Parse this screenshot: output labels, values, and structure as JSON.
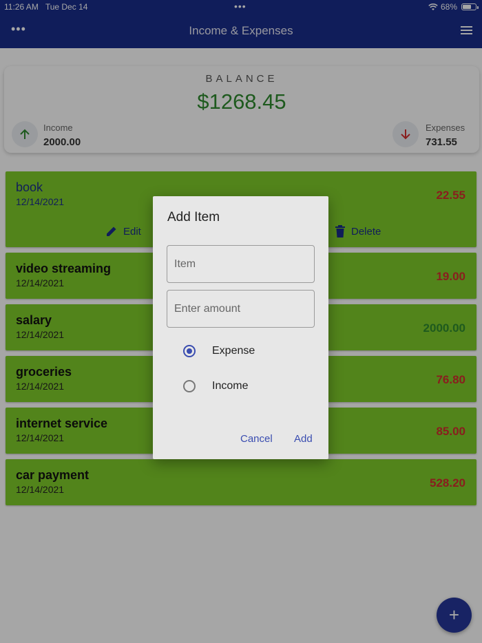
{
  "status_bar": {
    "time": "11:26 AM",
    "date": "Tue Dec 14",
    "battery": "68%",
    "center_dots": "•••"
  },
  "app_bar": {
    "title": "Income & Expenses",
    "more_glyph": "•••"
  },
  "balance": {
    "label": "BALANCE",
    "value": "$1268.45",
    "income_label": "Income",
    "income_value": "2000.00",
    "expenses_label": "Expenses",
    "expenses_value": "731.55"
  },
  "items": [
    {
      "name": "book",
      "date": "12/14/2021",
      "amount": "22.55",
      "type": "expense"
    },
    {
      "name": "video streaming",
      "date": "12/14/2021",
      "amount": "19.00",
      "type": "expense"
    },
    {
      "name": "salary",
      "date": "12/14/2021",
      "amount": "2000.00",
      "type": "income"
    },
    {
      "name": "groceries",
      "date": "12/14/2021",
      "amount": "76.80",
      "type": "expense"
    },
    {
      "name": "internet service",
      "date": "12/14/2021",
      "amount": "85.00",
      "type": "expense"
    },
    {
      "name": "car payment",
      "date": "12/14/2021",
      "amount": "528.20",
      "type": "expense"
    }
  ],
  "item_actions": {
    "edit_label": "Edit",
    "delete_label": "Delete"
  },
  "dialog": {
    "title": "Add Item",
    "item_placeholder": "Item",
    "amount_placeholder": "Enter amount",
    "options": [
      "Expense",
      "Income"
    ],
    "selected": "Expense",
    "cancel_label": "Cancel",
    "add_label": "Add"
  },
  "fab_label": "+",
  "colors": {
    "primary": "#1a2d8a",
    "item_bg": "#7fcb2a",
    "income": "#2f8a2f",
    "expense": "#d32f2f"
  },
  "icons": [
    "wifi-icon",
    "battery-icon",
    "more-icon",
    "menu-icon",
    "arrow-up-icon",
    "arrow-down-icon",
    "edit-icon",
    "delete-icon",
    "plus-icon"
  ]
}
